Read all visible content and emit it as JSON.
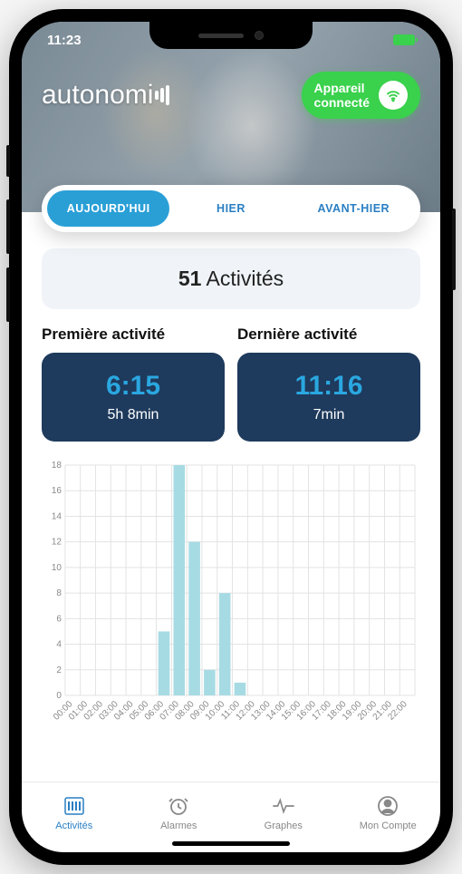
{
  "status": {
    "time": "11:23"
  },
  "header": {
    "logo_text": "autonomi",
    "connect_line1": "Appareil",
    "connect_line2": "connecté"
  },
  "tabs": [
    {
      "label": "AUJOURD'HUI",
      "active": true
    },
    {
      "label": "HIER",
      "active": false
    },
    {
      "label": "AVANT-HIER",
      "active": false
    }
  ],
  "summary": {
    "count": "51",
    "label": "Activités"
  },
  "first_activity": {
    "title": "Première activité",
    "time": "6:15",
    "sub": "5h 8min"
  },
  "last_activity": {
    "title": "Dernière activité",
    "time": "11:16",
    "sub": "7min"
  },
  "chart_data": {
    "type": "bar",
    "categories": [
      "00:00",
      "01:00",
      "02:00",
      "03:00",
      "04:00",
      "05:00",
      "06:00",
      "07:00",
      "08:00",
      "09:00",
      "10:00",
      "11:00",
      "12:00",
      "13:00",
      "14:00",
      "15:00",
      "16:00",
      "17:00",
      "18:00",
      "19:00",
      "20:00",
      "21:00",
      "22:00"
    ],
    "values": [
      0,
      0,
      0,
      0,
      0,
      0,
      5,
      18,
      12,
      2,
      8,
      1,
      0,
      0,
      0,
      0,
      0,
      0,
      0,
      0,
      0,
      0,
      0
    ],
    "ylim": [
      0,
      18
    ],
    "yticks": [
      0,
      2,
      4,
      6,
      8,
      10,
      12,
      14,
      16,
      18
    ],
    "xlabel": "",
    "ylabel": ""
  },
  "nav": [
    {
      "label": "Activités",
      "icon": "activities-icon",
      "active": true
    },
    {
      "label": "Alarmes",
      "icon": "alarms-icon",
      "active": false
    },
    {
      "label": "Graphes",
      "icon": "graphs-icon",
      "active": false
    },
    {
      "label": "Mon Compte",
      "icon": "account-icon",
      "active": false
    }
  ]
}
